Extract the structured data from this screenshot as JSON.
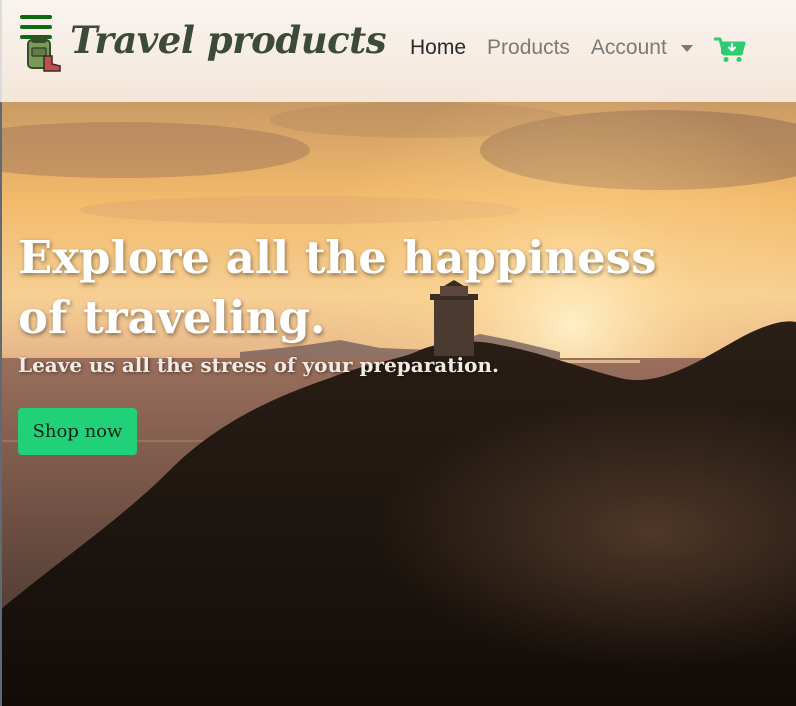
{
  "navbar": {
    "brand": "Travel products",
    "links": [
      {
        "label": "Home",
        "active": true
      },
      {
        "label": "Products",
        "active": false
      },
      {
        "label": "Account",
        "active": false
      }
    ],
    "icons": {
      "menu": "hamburger-menu-icon",
      "logo": "backpack-logo-icon",
      "cart": "cart-download-icon"
    }
  },
  "hero": {
    "title": "Explore all the happiness of traveling.",
    "subtitle": "Leave us all the stress of your preparation.",
    "cta_label": "Shop now",
    "background": "sunset-lighthouse-cliff-photo"
  },
  "colors": {
    "accent": "#21d17a",
    "menu_icon": "#0f6b0f",
    "brand_text": "#3c4a3c",
    "nav_active": "#2a2a2a",
    "nav_inactive": "#7d7a76"
  }
}
